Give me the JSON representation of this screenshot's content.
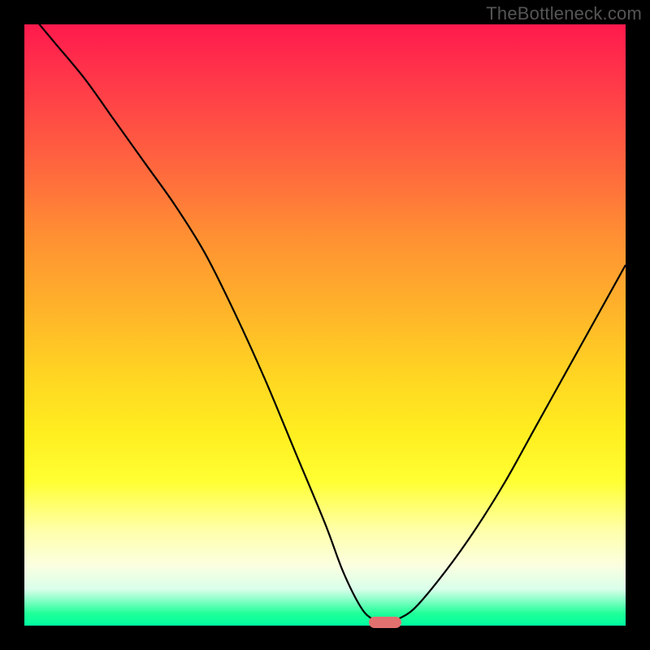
{
  "watermark": "TheBottleneck.com",
  "chart_data": {
    "type": "line",
    "title": "",
    "xlabel": "",
    "ylabel": "",
    "xlim": [
      0,
      100
    ],
    "ylim": [
      0,
      100
    ],
    "grid": false,
    "legend": false,
    "series": [
      {
        "name": "curve",
        "x": [
          0,
          5,
          10,
          15,
          20,
          25,
          30,
          35,
          40,
          45,
          50,
          53,
          56,
          58,
          60,
          62,
          65,
          70,
          75,
          80,
          85,
          90,
          95,
          100
        ],
        "y": [
          103,
          97,
          91,
          84,
          77,
          70,
          62,
          52,
          41,
          29,
          17,
          9,
          3,
          1,
          0,
          1,
          3,
          9,
          16,
          24,
          33,
          42,
          51,
          60
        ],
        "color": "#000000"
      }
    ],
    "marker": {
      "x": 60,
      "y": 0.5,
      "color": "#e1706f",
      "shape": "rounded-bar"
    }
  }
}
